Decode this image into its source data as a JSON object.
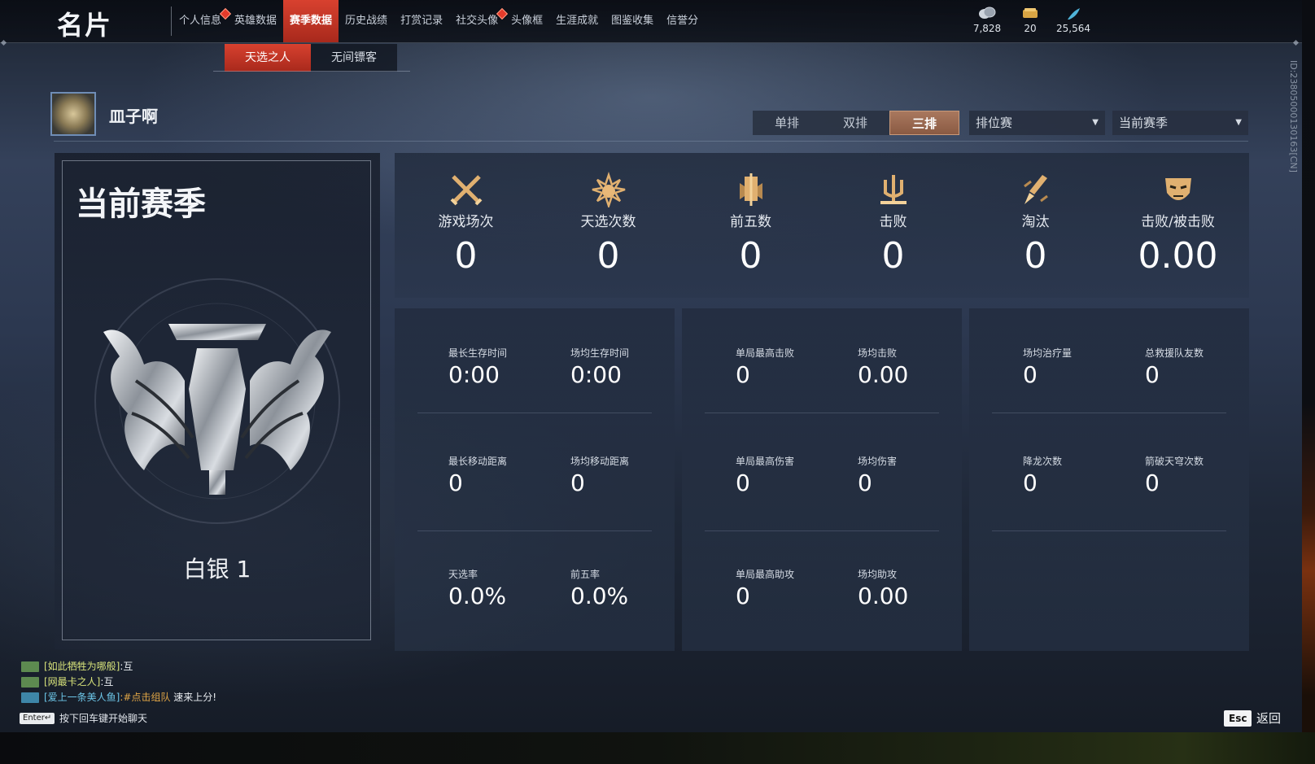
{
  "app": {
    "title": "名片"
  },
  "nav": {
    "tabs": [
      {
        "label": "个人信息",
        "badge": true
      },
      {
        "label": "英雄数据",
        "badge": false
      },
      {
        "label": "赛季数据",
        "badge": false,
        "active": true
      },
      {
        "label": "历史战绩",
        "badge": false
      },
      {
        "label": "打赏记录",
        "badge": false
      },
      {
        "label": "社交头像",
        "badge": true
      },
      {
        "label": "头像框",
        "badge": false
      },
      {
        "label": "生涯成就",
        "badge": false
      },
      {
        "label": "图鉴收集",
        "badge": false
      },
      {
        "label": "信誉分",
        "badge": false
      }
    ],
    "subtabs": [
      {
        "label": "天选之人",
        "active": true
      },
      {
        "label": "无间镖客",
        "active": false
      }
    ]
  },
  "currencies": [
    {
      "icon": "coin-icon",
      "value": "7,828"
    },
    {
      "icon": "ticket-icon",
      "value": "20"
    },
    {
      "icon": "feather-icon",
      "value": "25,564"
    }
  ],
  "profile": {
    "name": "皿子啊"
  },
  "mode": {
    "segments": [
      {
        "label": "单排",
        "active": false
      },
      {
        "label": "双排",
        "active": false
      },
      {
        "label": "三排",
        "active": true
      }
    ],
    "match_type": "排位赛",
    "season_select": "当前赛季"
  },
  "season": {
    "title": "当前赛季",
    "rank": "白银 1"
  },
  "summary_stats": [
    {
      "icon": "crossed-swords-icon",
      "label": "游戏场次",
      "value": "0"
    },
    {
      "icon": "flower-crest-icon",
      "label": "天选次数",
      "value": "0"
    },
    {
      "icon": "banner-icon",
      "label": "前五数",
      "value": "0"
    },
    {
      "icon": "trident-icon",
      "label": "击败",
      "value": "0"
    },
    {
      "icon": "broken-blade-icon",
      "label": "淘汰",
      "value": "0"
    },
    {
      "icon": "mask-icon",
      "label": "击败/被击败",
      "value": "0.00"
    }
  ],
  "panels": [
    {
      "cells": [
        {
          "label": "最长生存时间",
          "value": "0:00"
        },
        {
          "label": "场均生存时间",
          "value": "0:00"
        },
        {
          "label": "最长移动距离",
          "value": "0"
        },
        {
          "label": "场均移动距离",
          "value": "0"
        },
        {
          "label": "天选率",
          "value": "0.0%"
        },
        {
          "label": "前五率",
          "value": "0.0%"
        }
      ]
    },
    {
      "cells": [
        {
          "label": "单局最高击败",
          "value": "0"
        },
        {
          "label": "场均击败",
          "value": "0.00"
        },
        {
          "label": "单局最高伤害",
          "value": "0"
        },
        {
          "label": "场均伤害",
          "value": "0"
        },
        {
          "label": "单局最高助攻",
          "value": "0"
        },
        {
          "label": "场均助攻",
          "value": "0.00"
        }
      ]
    },
    {
      "cells": [
        {
          "label": "场均治疗量",
          "value": "0"
        },
        {
          "label": "总救援队友数",
          "value": "0"
        },
        {
          "label": "降龙次数",
          "value": "0"
        },
        {
          "label": "箭破天穹次数",
          "value": "0"
        }
      ]
    }
  ],
  "chat": {
    "lines": [
      {
        "name": "[如此牺牲为哪般]",
        "text": ":互",
        "link": ""
      },
      {
        "name": "[网最卡之人]",
        "text": ":互",
        "link": ""
      },
      {
        "name": "[爱上一条美人鱼]",
        "link": ":#点击组队",
        "text": " 速来上分!"
      }
    ],
    "enter_key": "Enter↵",
    "hint": "按下回车键开始聊天"
  },
  "footer": {
    "esc_key": "Esc",
    "back_label": "返回"
  },
  "meta_id": "ID:2380500013016​3[CN]"
}
